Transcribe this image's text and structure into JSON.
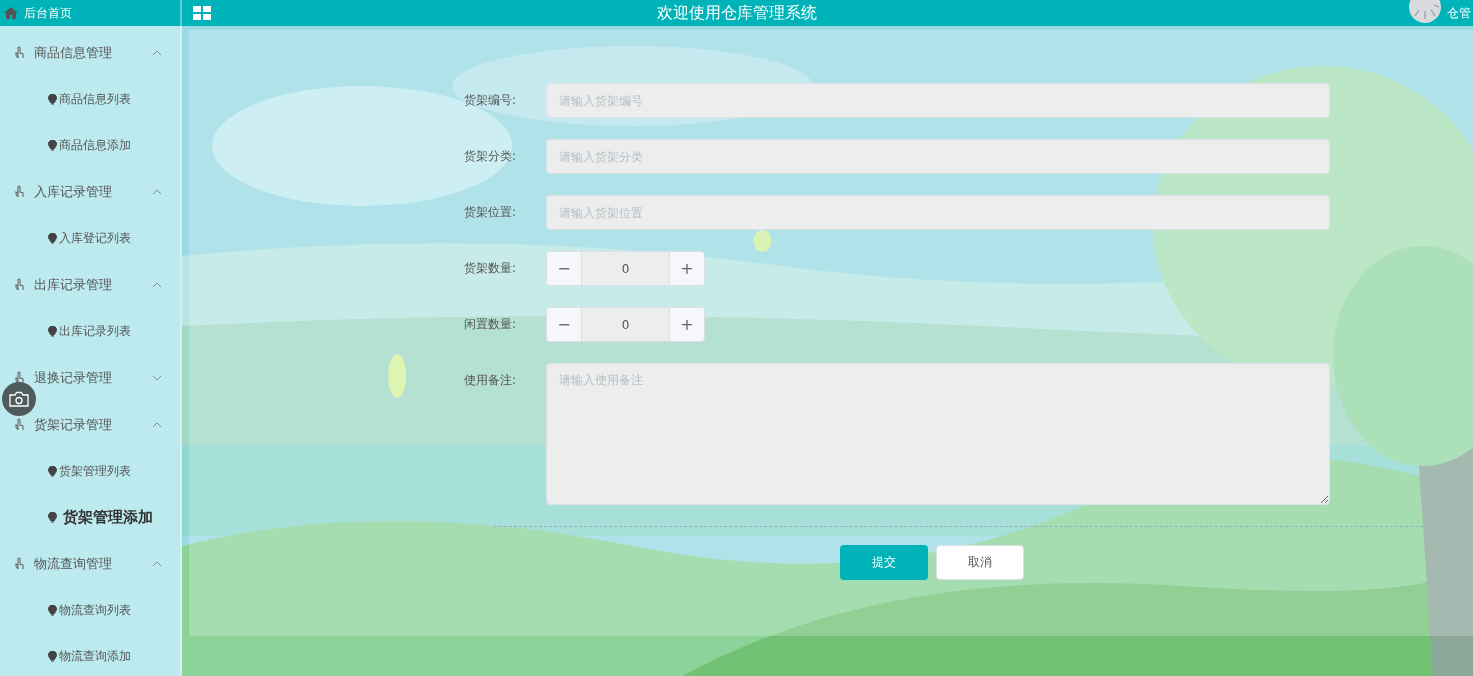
{
  "header": {
    "home_label": "后台首页",
    "title": "欢迎使用仓库管理系统",
    "user_label": "仓管"
  },
  "sidebar": {
    "groups": [
      {
        "label": "商品信息管理",
        "expanded": true,
        "children": [
          {
            "label": "商品信息列表",
            "selected": false
          },
          {
            "label": "商品信息添加",
            "selected": false
          }
        ]
      },
      {
        "label": "入库记录管理",
        "expanded": true,
        "children": [
          {
            "label": "入库登记列表",
            "selected": false
          }
        ]
      },
      {
        "label": "出库记录管理",
        "expanded": true,
        "children": [
          {
            "label": "出库记录列表",
            "selected": false
          }
        ]
      },
      {
        "label": "退换记录管理",
        "expanded": false
      },
      {
        "label": "货架记录管理",
        "expanded": true,
        "children": [
          {
            "label": "货架管理列表",
            "selected": false
          },
          {
            "label": "货架管理添加",
            "selected": true
          }
        ]
      },
      {
        "label": "物流查询管理",
        "expanded": true,
        "children": [
          {
            "label": "物流查询列表",
            "selected": false
          },
          {
            "label": "物流查询添加",
            "selected": false
          }
        ]
      }
    ]
  },
  "form": {
    "fields": [
      {
        "kind": "text",
        "label": "货架编号:",
        "placeholder": "请输入货架编号"
      },
      {
        "kind": "text",
        "label": "货架分类:",
        "placeholder": "请输入货架分类"
      },
      {
        "kind": "text",
        "label": "货架位置:",
        "placeholder": "请输入货架位置"
      },
      {
        "kind": "number",
        "label": "货架数量:",
        "value": "0",
        "decrement": "−",
        "increment": "+"
      },
      {
        "kind": "number",
        "label": "闲置数量:",
        "value": "0",
        "decrement": "−",
        "increment": "+"
      },
      {
        "kind": "textarea",
        "label": "使用备注:",
        "placeholder": "请输入使用备注"
      }
    ],
    "buttons": [
      {
        "kind": "primary",
        "label": "提交"
      },
      {
        "kind": "default",
        "label": "取消"
      }
    ]
  }
}
